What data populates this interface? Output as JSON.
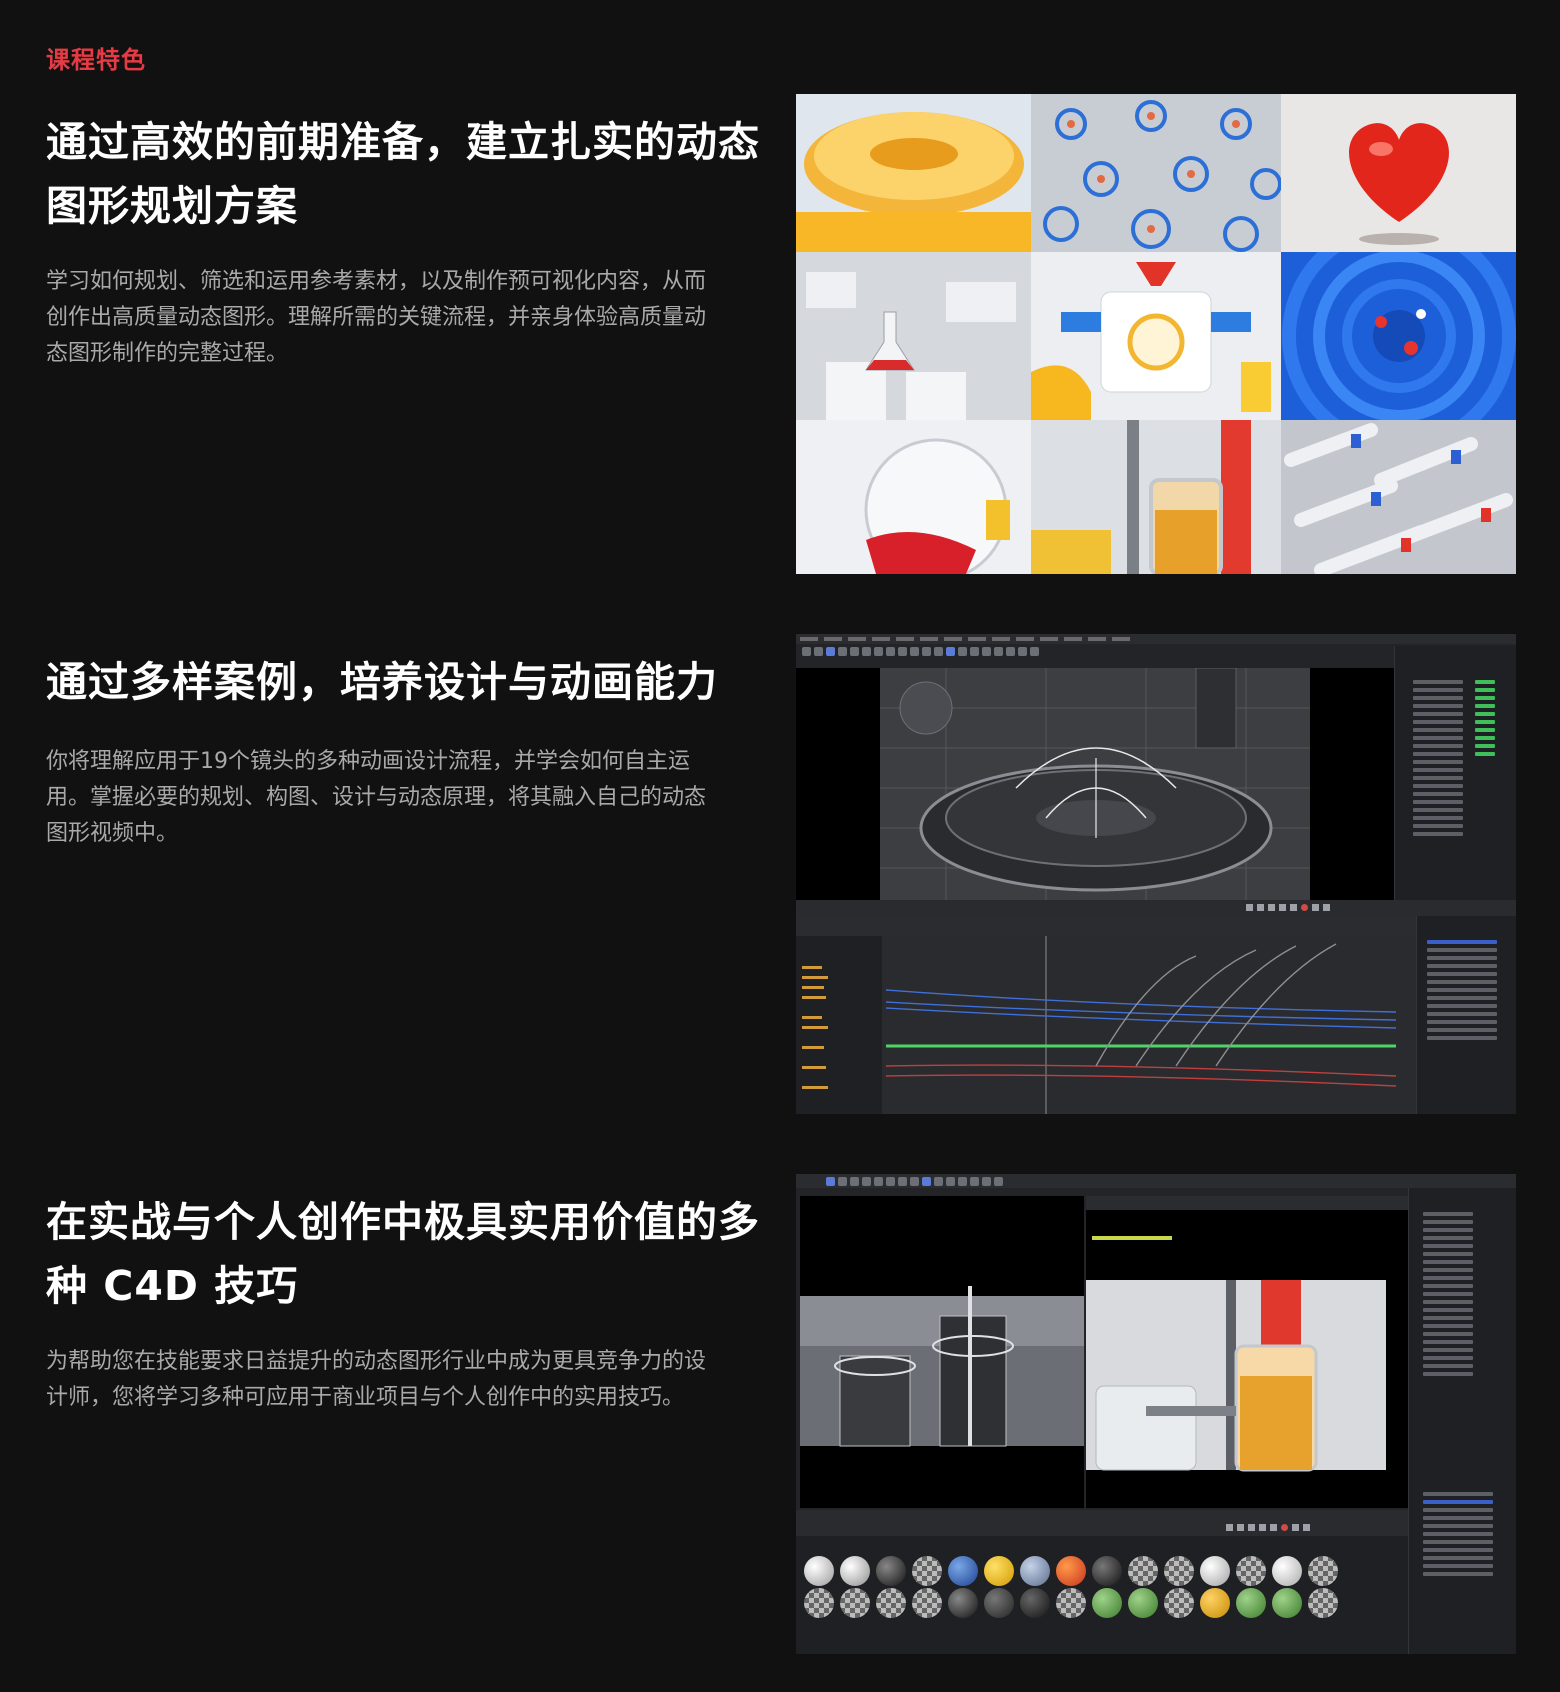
{
  "section": {
    "eyebrow": "课程特色",
    "accent_color": "#e63b45"
  },
  "features": [
    {
      "title_line1": "通过高效的前期准备，建立扎实的动态",
      "title_line2": "图形规划方案",
      "desc_line1": "学习如何规划、筛选和运用参考素材，以及制作预可视化内容，从而",
      "desc_line2": "创作出高质量动态图形。理解所需的关键流程，并亲身体验高质量动",
      "desc_line3": "态图形制作的完整过程。",
      "media": "image-grid-3x3"
    },
    {
      "title_line1": "通过多样案例，培养设计与动画能力",
      "desc_line1": "你将理解应用于19个镜头的多种动画设计流程，并学会如何自主运",
      "desc_line2": "用。掌握必要的规划、构图、设计与动态原理，将其融入自己的动态",
      "desc_line3": "图形视频中。",
      "media": "c4d-viewport-and-fcurve-editor"
    },
    {
      "title_line1": "在实战与个人创作中极具实用价值的多",
      "title_line2": "种 C4D 技巧",
      "desc_line1": "为帮助您在技能要求日益提升的动态图形行业中成为更具竞争力的设",
      "desc_line2": "计师，您将学习多种可应用于商业项目与个人创作中的实用技巧。",
      "media": "c4d-viewport-render-and-materials"
    }
  ]
}
